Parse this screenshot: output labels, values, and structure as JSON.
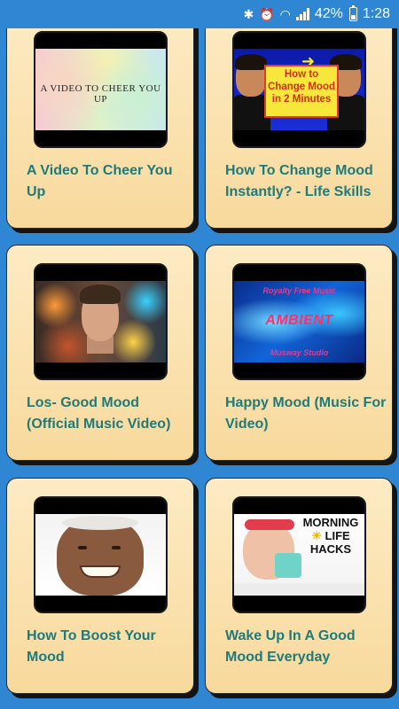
{
  "status_bar": {
    "icons": [
      "bluetooth-icon",
      "alarm-icon",
      "wifi-icon",
      "signal-icon",
      "battery-icon"
    ],
    "battery": "42%",
    "time": "1:28"
  },
  "colors": {
    "background": "#2f86d3",
    "card": "#fbe1ad",
    "title": "#1f7a7a"
  },
  "videos": [
    {
      "title": "A Video To Cheer You Up",
      "thumbnail_text": "A VIDEO TO CHEER YOU UP"
    },
    {
      "title": "How To Change Mood Instantly? - Life Skills",
      "thumbnail_text": "How to Change Mood in 2 Minutes"
    },
    {
      "title": "Los- Good Mood (Official Music Video)",
      "thumbnail_text": ""
    },
    {
      "title": "Happy Mood (Music For Video)",
      "thumbnail_text_top": "Royalty Free Music",
      "thumbnail_text_main": "AMBIENT",
      "thumbnail_text_bottom": "Musway Studio"
    },
    {
      "title": "How To Boost Your Mood",
      "thumbnail_text": ""
    },
    {
      "title": "Wake Up In A Good Mood Everyday",
      "thumbnail_text_line1": "MORNING",
      "thumbnail_text_line2": "LIFE",
      "thumbnail_text_line3": "HACKS"
    }
  ]
}
